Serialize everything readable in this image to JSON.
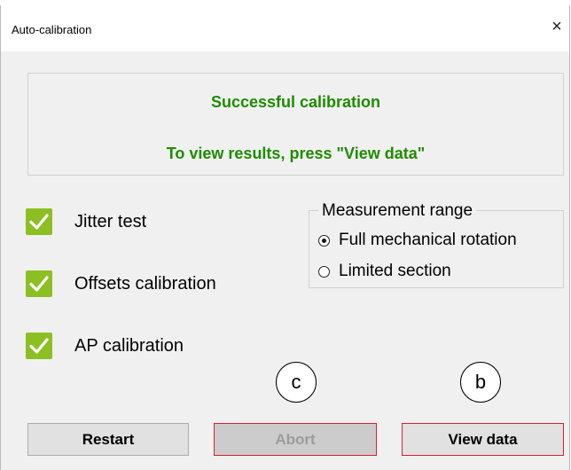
{
  "window": {
    "title": "Auto-calibration",
    "close_glyph": "×"
  },
  "status": {
    "line1": "Successful calibration",
    "line2": "To view results, press \"View data\"",
    "color": "#1e8c00"
  },
  "checks": [
    {
      "label": "Jitter test",
      "checked": true
    },
    {
      "label": "Offsets calibration",
      "checked": true
    },
    {
      "label": "AP calibration",
      "checked": true
    }
  ],
  "check_color": "#8cbf22",
  "range": {
    "title": "Measurement range",
    "options": [
      {
        "label": "Full mechanical rotation",
        "selected": true
      },
      {
        "label": "Limited section",
        "selected": false
      }
    ]
  },
  "callouts": {
    "c": "c",
    "b": "b"
  },
  "buttons": {
    "restart": "Restart",
    "abort": "Abort",
    "view": "View data"
  },
  "highlight_color": "#d81f2a"
}
